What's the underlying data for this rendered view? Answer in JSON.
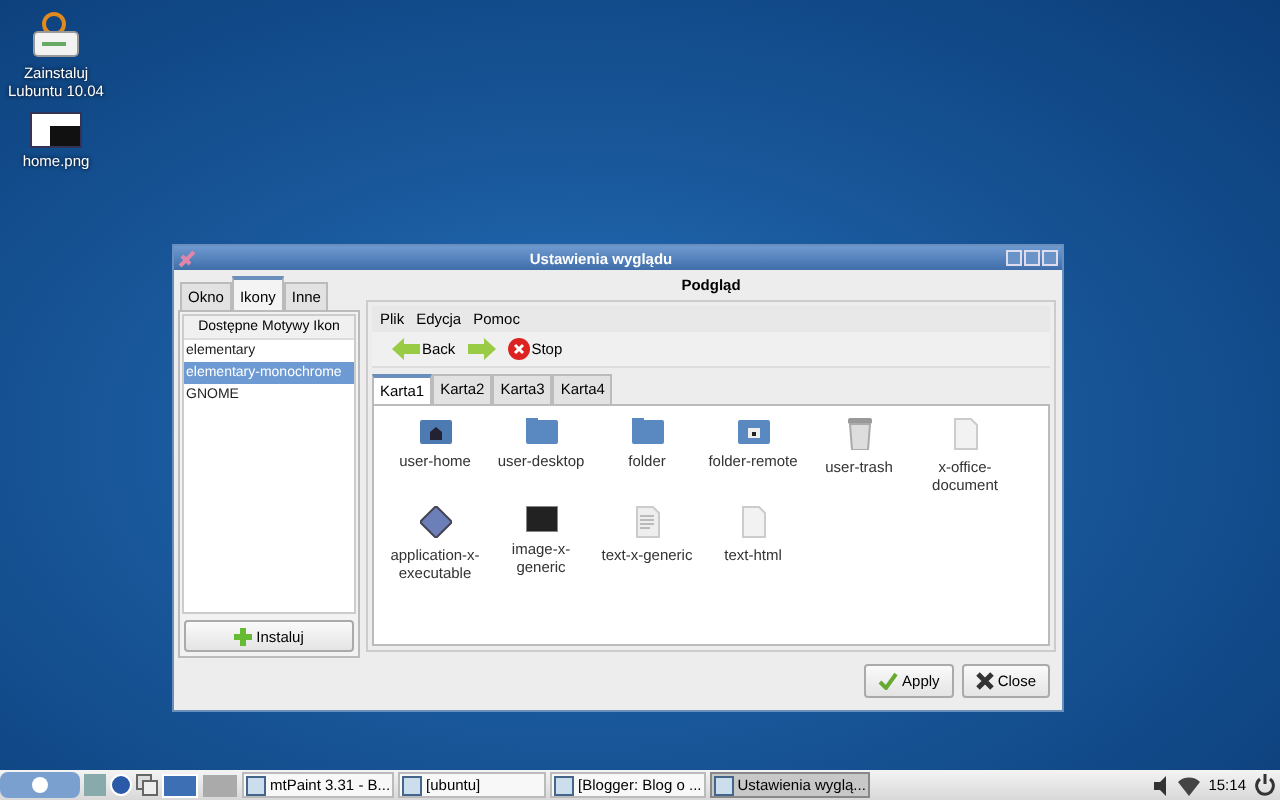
{
  "desktop_icons": [
    {
      "label": "Zainstaluj Lubuntu 10.04",
      "kind": "installer"
    },
    {
      "label": "home.png",
      "kind": "image"
    }
  ],
  "window": {
    "title": "Ustawienia wyglądu",
    "tabs": [
      {
        "label": "Okno",
        "selected": false
      },
      {
        "label": "Ikony",
        "selected": true
      },
      {
        "label": "Inne",
        "selected": false
      }
    ],
    "theme_list": {
      "header": "Dostępne Motywy Ikon",
      "items": [
        {
          "label": "elementary",
          "selected": false
        },
        {
          "label": "elementary-monochrome",
          "selected": true
        },
        {
          "label": "GNOME",
          "selected": false
        }
      ]
    },
    "install_button": "Instaluj",
    "preview": {
      "title": "Podgląd",
      "menu": [
        "Plik",
        "Edycja",
        "Pomoc"
      ],
      "toolbar": [
        {
          "kind": "back",
          "label": "Back"
        },
        {
          "kind": "forward"
        },
        {
          "kind": "stop",
          "label": "Stop"
        }
      ],
      "tabs": [
        {
          "label": "Karta1",
          "selected": true
        },
        {
          "label": "Karta2",
          "selected": false
        },
        {
          "label": "Karta3",
          "selected": false
        },
        {
          "label": "Karta4",
          "selected": false
        }
      ],
      "icons": [
        {
          "label": "user-home",
          "kind": "home"
        },
        {
          "label": "user-desktop",
          "kind": "desktop"
        },
        {
          "label": "folder",
          "kind": "folder"
        },
        {
          "label": "folder-remote",
          "kind": "remote"
        },
        {
          "label": "user-trash",
          "kind": "trash"
        },
        {
          "label": "x-office-document",
          "kind": "document"
        },
        {
          "label": "application-x-executable",
          "kind": "executable"
        },
        {
          "label": "image-x-generic",
          "kind": "image"
        },
        {
          "label": "text-x-generic",
          "kind": "text"
        },
        {
          "label": "text-html",
          "kind": "document"
        }
      ]
    },
    "buttons": [
      {
        "label": "Apply",
        "kind": "apply"
      },
      {
        "label": "Close",
        "kind": "close"
      }
    ]
  },
  "taskbar": {
    "tasks": [
      {
        "label": "mtPaint 3.31 - B...",
        "selected": false
      },
      {
        "label": "[ubuntu]",
        "selected": false
      },
      {
        "label": "[Blogger: Blog o ...",
        "selected": false
      },
      {
        "label": "Ustawienia wyglą...",
        "selected": true
      }
    ],
    "clock": "15:14"
  }
}
